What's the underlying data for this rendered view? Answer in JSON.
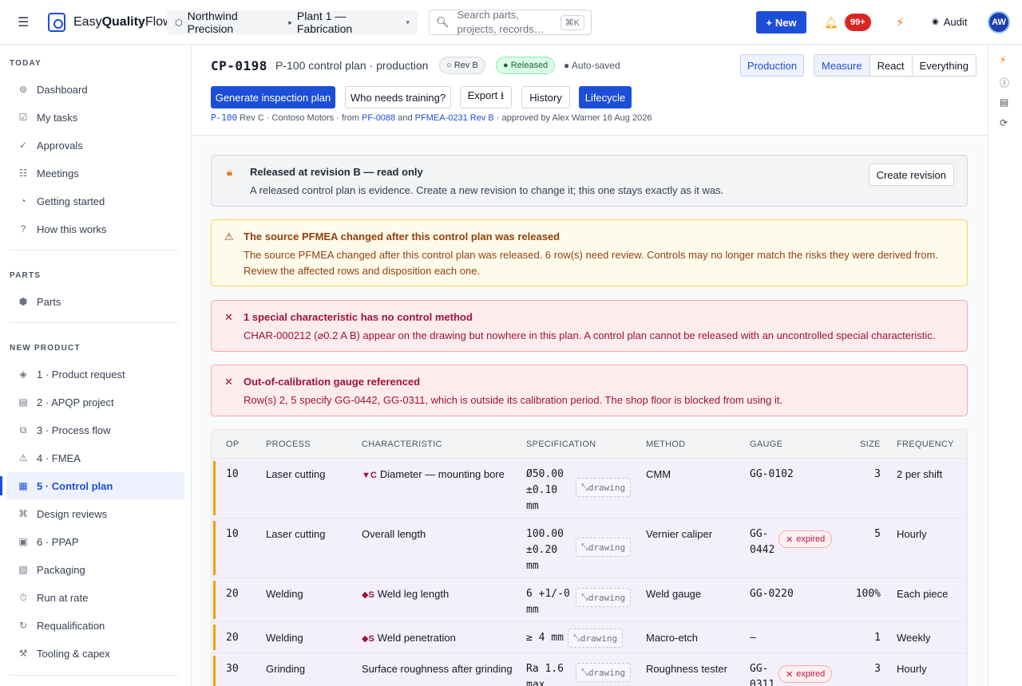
{
  "topbar": {
    "brand_a": "Easy",
    "brand_b": "Quality",
    "brand_c": "Flow",
    "plant_org": "Northwind Precision",
    "plant_name": "Plant 1 — Fabrication",
    "search_placeholder": "Search parts, projects, records…",
    "search_kbd": "⌘K",
    "new_label": "New",
    "notif_count": "99+",
    "audit_label": "Audit",
    "avatar_initials": "AW"
  },
  "sidebar": {
    "sections": {
      "today": "TODAY",
      "parts": "PARTS",
      "new_product": "NEW PRODUCT"
    },
    "today": [
      {
        "icon": "⊚",
        "label": "Dashboard"
      },
      {
        "icon": "☑",
        "label": "My tasks"
      },
      {
        "icon": "✓",
        "label": "Approvals"
      },
      {
        "icon": "☷",
        "label": "Meetings"
      },
      {
        "icon": "◔",
        "label": "Getting started"
      },
      {
        "icon": "?",
        "label": "How this works"
      }
    ],
    "parts": [
      {
        "icon": "⬢",
        "label": "Parts"
      }
    ],
    "new_product": [
      {
        "icon": "◈",
        "label": "1 · Product request"
      },
      {
        "icon": "▤",
        "label": "2 · APQP project"
      },
      {
        "icon": "⧉",
        "label": "3 · Process flow"
      },
      {
        "icon": "⚠",
        "label": "4 · FMEA"
      },
      {
        "icon": "▦",
        "label": "5 · Control plan"
      },
      {
        "icon": "⌘",
        "label": "Design reviews"
      },
      {
        "icon": "▣",
        "label": "6 · PPAP"
      },
      {
        "icon": "▧",
        "label": "Packaging"
      },
      {
        "icon": "⏱",
        "label": "Run at rate"
      },
      {
        "icon": "↻",
        "label": "Requalification"
      },
      {
        "icon": "⚒",
        "label": "Tooling & capex"
      }
    ]
  },
  "header": {
    "id": "CP-0198",
    "title": "P-100 control plan · production",
    "rev": "Rev B",
    "status": "Released",
    "autosaved": "Auto-saved",
    "mode": "Production",
    "segments": [
      "Measure",
      "React",
      "Everything"
    ],
    "actions": [
      "Generate inspection plan",
      "Who needs training?",
      "Export ⭳",
      "History",
      "Lifecycle"
    ],
    "lineage": {
      "part": "P-100",
      "t1": " Rev C · Contoso Motors · from ",
      "pf": "PF-0088",
      "t2": " and ",
      "pfmea": "PFMEA-0231 Rev B",
      "t3": " · approved by Alex Warner 16 Aug 2026"
    }
  },
  "banners": {
    "released": {
      "title": "Released at revision B — read only",
      "desc": "A released control plan is evidence. Create a new revision to change it; this one stays exactly as it was.",
      "button": "Create revision"
    },
    "pfmea": {
      "title": "The source PFMEA changed after this control plan was released",
      "desc": "The source PFMEA changed after this control plan was released. 6 row(s) need review. Controls may no longer match the risks they were derived from. Review the affected rows and disposition each one."
    },
    "special": {
      "title": "1 special characteristic has no control method",
      "desc": "CHAR-000212 (⌀0.2 A B) appear on the drawing but nowhere in this plan. A control plan cannot be released with an uncontrolled special characteristic."
    },
    "gauge": {
      "title": "Out-of-calibration gauge referenced",
      "desc": "Row(s) 2, 5 specify GG-0442, GG-0311, which is outside its calibration period. The shop floor is blocked from using it."
    }
  },
  "table": {
    "headers": [
      "OP",
      "PROCESS",
      "CHARACTERISTIC",
      "SPECIFICATION",
      "METHOD",
      "GAUGE",
      "SIZE",
      "FREQUENCY"
    ],
    "drawing_label": "drawing",
    "expired_label": "expired",
    "rows": [
      {
        "op": "10",
        "process": "Laser cutting",
        "mark": "▼C",
        "char": "Diameter — mounting bore",
        "spec": [
          "Ø50.00",
          "±0.10",
          "mm"
        ],
        "method": "CMM",
        "gauge": [
          "GG-0102"
        ],
        "size": "3",
        "freq": "2 per shift"
      },
      {
        "op": "10",
        "process": "Laser cutting",
        "mark": "",
        "char": "Overall length",
        "spec": [
          "100.00",
          "±0.20",
          "mm"
        ],
        "method": "Vernier caliper",
        "gauge": [
          "GG-",
          "0442"
        ],
        "size": "5",
        "freq": "Hourly"
      },
      {
        "op": "20",
        "process": "Welding",
        "mark": "◆S",
        "char": "Weld leg length",
        "spec": [
          "6 +1/-0",
          "mm"
        ],
        "method": "Weld gauge",
        "gauge": [
          "GG-0220"
        ],
        "size": "100%",
        "freq": "Each piece"
      },
      {
        "op": "20",
        "process": "Welding",
        "mark": "◆S",
        "char": "Weld penetration",
        "spec": [
          "≥ 4 mm"
        ],
        "method": "Macro-etch",
        "gauge": [
          "—"
        ],
        "size": "1",
        "freq": "Weekly"
      },
      {
        "op": "30",
        "process": "Grinding",
        "mark": "",
        "char": "Surface roughness after grinding",
        "spec": [
          "Ra 1.6",
          "max"
        ],
        "method": "Roughness tester",
        "gauge": [
          "GG-",
          "0311"
        ],
        "size": "3",
        "freq": "Hourly"
      }
    ]
  },
  "colors": {
    "accent": "#1d4ed8",
    "warning": "#f59e0b",
    "danger": "#9f1239",
    "success": "#166534"
  }
}
